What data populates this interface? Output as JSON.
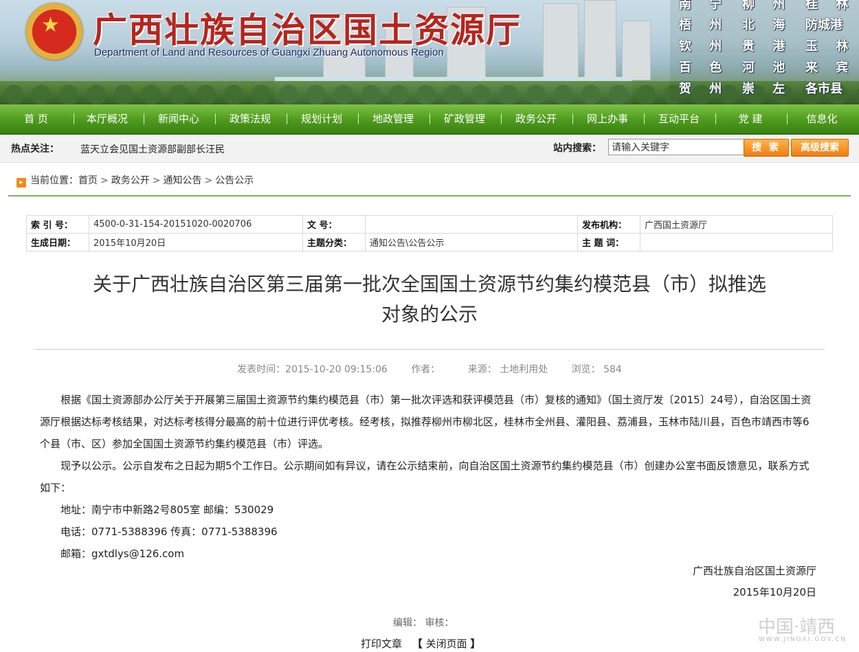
{
  "header": {
    "title_cn": "广西壮族自治区国土资源厅",
    "title_en": "Department of Land and Resources of Guangxi Zhuang Autonomous Region",
    "cities": [
      [
        "南 宁",
        "柳 州",
        "桂 林"
      ],
      [
        "梧 州",
        "北 海",
        "防城港"
      ],
      [
        "钦 州",
        "贵 港",
        "玉 林"
      ],
      [
        "百 色",
        "河 池",
        "来 宾"
      ],
      [
        "贺 州",
        "崇 左",
        "各市县"
      ]
    ]
  },
  "nav": [
    "首 页",
    "本厅概况",
    "新闻中心",
    "政策法规",
    "规划计划",
    "地政管理",
    "矿政管理",
    "政务公开",
    "网上办事",
    "互动平台",
    "党 建",
    "信息化"
  ],
  "hotbar": {
    "label": "热点关注：",
    "news": "蓝天立会见国土资源部副部长汪民",
    "search_label": "站内搜索：",
    "search_placeholder": "请输入关键字",
    "search_btn": "搜 索",
    "adv_btn": "高级搜索"
  },
  "breadcrumb": {
    "prefix": "当前位置：",
    "items": [
      "首页",
      "政务公开",
      "通知公告",
      "公告公示"
    ]
  },
  "meta": {
    "index_key": "索 引 号：",
    "index_val": "4500-0-31-154-20151020-0020706",
    "doc_key": "文 号：",
    "doc_val": "",
    "org_key": "发布机构：",
    "org_val": "广西国土资源厅",
    "date_key": "生成日期：",
    "date_val": "2015年10月20日",
    "topic_key": "主题分类：",
    "topic_val": "通知公告\\公告公示",
    "kw_key": "主 题 词：",
    "kw_val": ""
  },
  "article": {
    "title_line1": "关于广西壮族自治区第三届第一批次全国国土资源节约集约模范县（市）拟推选",
    "title_line2": "对象的公示",
    "publish_time": "发表时间：2015-10-20 09:15:06",
    "author": "作者：",
    "source": "来源： 土地利用处",
    "views": "浏览： 584",
    "p1": "根据《国土资源部办公厅关于开展第三届国土资源节约集约模范县（市）第一批次评选和获评模范县（市）复核的通知》（国土资厅发〔2015〕24号），自治区国土资源厅根据达标考核结果，对达标考核得分最高的前十位进行评优考核。经考核，拟推荐柳州市柳北区，桂林市全州县、灌阳县、荔浦县，玉林市陆川县，百色市靖西市等6个县（市、区）参加全国国土资源节约集约模范县（市）评选。",
    "p2": "现予以公示。公示自发布之日起为期5个工作日。公示期间如有异议，请在公示结束前，向自治区国土资源节约集约模范县（市）创建办公室书面反馈意见，联系方式如下：",
    "address": "地址：南宁市中新路2号805室 邮编：530029",
    "phone": "电话：0771-5388396 传真：0771-5388396",
    "email": "邮箱：gxtdlys@126.com",
    "sign_org": "广西壮族自治区国土资源厅",
    "sign_date": "2015年10月20日",
    "editor": "编辑：  审核：",
    "print": "打印文章",
    "close": "关闭页面",
    "bracket_l": "【",
    "bracket_r": "】"
  },
  "watermark": {
    "main": "中国·靖西",
    "sub": "WWW.JINGXI.GOV.CN"
  }
}
